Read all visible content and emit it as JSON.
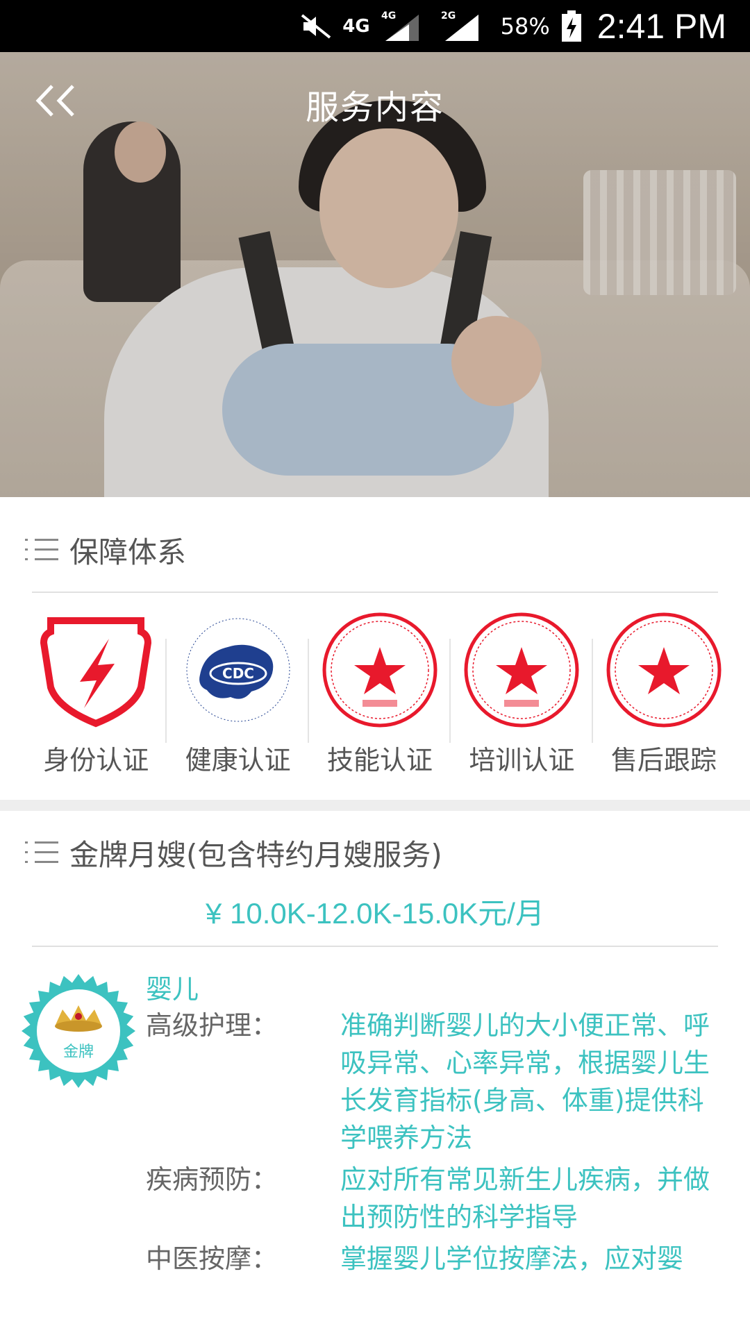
{
  "status_bar": {
    "network_1": "4G",
    "network_2": "4G",
    "network_3": "2G",
    "battery_percent": "58%",
    "time": "2:41 PM"
  },
  "header": {
    "title": "服务内容",
    "back_icon": "double-chevron-left-icon"
  },
  "guarantee": {
    "title": "保障体系",
    "items": [
      {
        "label": "身份认证",
        "icon": "shield-lightning-icon"
      },
      {
        "label": "健康认证",
        "icon": "cdc-logo"
      },
      {
        "label": "技能认证",
        "icon": "red-seal-icon"
      },
      {
        "label": "培训认证",
        "icon": "red-seal-icon"
      },
      {
        "label": "售后跟踪",
        "icon": "red-seal-icon"
      }
    ]
  },
  "service": {
    "title": "金牌月嫂(包含特约月嫂服务)",
    "price": "¥ 10.0K-12.0K-15.0K元/月",
    "medal_label": "金牌",
    "category": "婴儿",
    "details": [
      {
        "key": "高级护理：",
        "value": "准确判断婴儿的大小便正常、呼吸异常、心率异常，根据婴儿生长发育指标(身高、体重)提供科学喂养方法"
      },
      {
        "key": "疾病预防：",
        "value": "应对所有常见新生儿疾病，并做出预防性的科学指导"
      },
      {
        "key": "中医按摩：",
        "value": "掌握婴儿学位按摩法，应对婴"
      }
    ]
  },
  "colors": {
    "accent": "#3cc2c0",
    "seal_red": "#e8192c",
    "status_bar_bg": "#000000"
  }
}
